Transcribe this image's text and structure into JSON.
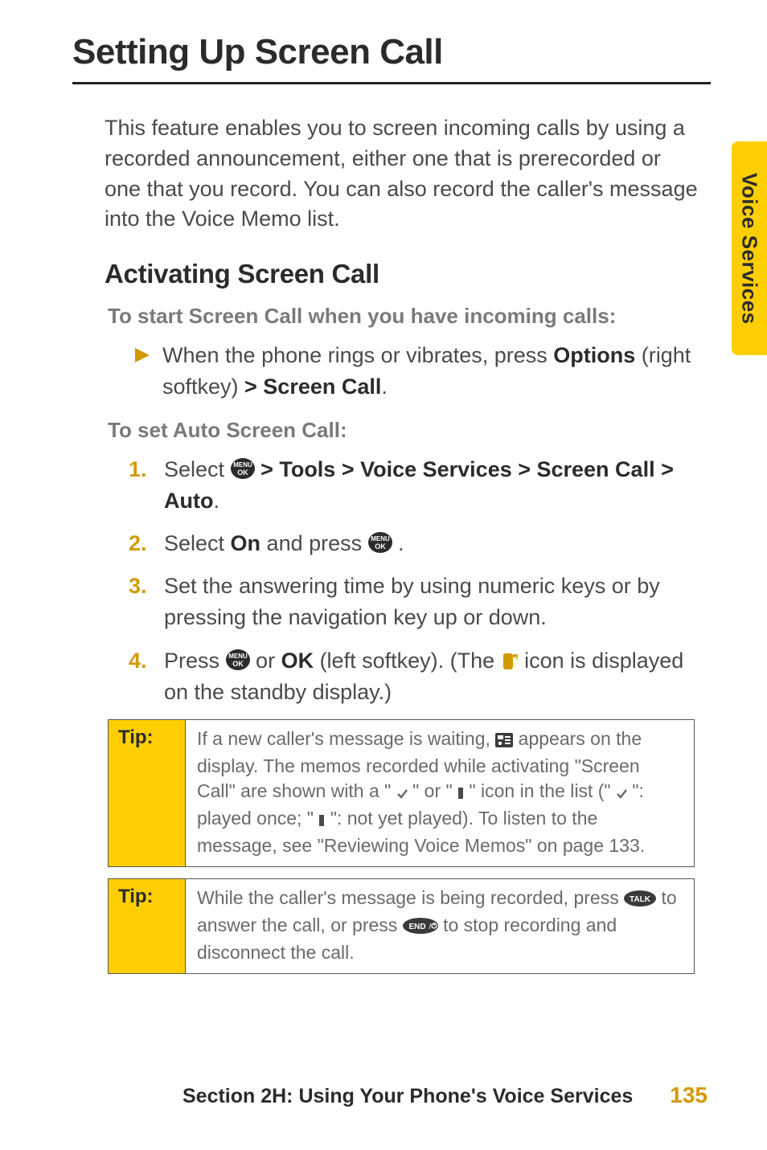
{
  "heading": "Setting Up Screen Call",
  "intro": "This feature enables you to screen incoming calls by using a recorded announcement, either one that is prerecorded or one that you record. You can also record the caller's message into the Voice Memo list.",
  "subheading": "Activating Screen Call",
  "subhead1": "To start Screen Call when you have incoming calls:",
  "bullet": {
    "prefix": "When the phone rings or vibrates, press ",
    "bold1": "Options",
    "mid": " (right softkey) ",
    "bold2": "> Screen Call",
    "suffix": "."
  },
  "subhead2": "To set Auto Screen Call:",
  "steps": {
    "n1": "1.",
    "s1_pre": "Select ",
    "s1_bold": " > Tools > Voice Services > Screen Call > Auto",
    "s1_post": ".",
    "n2": "2.",
    "s2_pre": "Select ",
    "s2_bold": "On",
    "s2_mid": " and press ",
    "s2_post": " .",
    "n3": "3.",
    "s3": "Set the answering time by using numeric keys or by pressing the navigation key up or down.",
    "n4": "4.",
    "s4_pre": "Press ",
    "s4_mid1": " or ",
    "s4_bold": "OK",
    "s4_mid2": " (left softkey). (The ",
    "s4_post": " icon is displayed on the standby display.)"
  },
  "tip1": {
    "label": "Tip:",
    "t_pre": "If a new caller's message is waiting, ",
    "t_mid1": " appears on the display. The memos recorded while activating \"Screen Call\" are shown with a \" ",
    "t_mid2": " \" or \" ",
    "t_mid3": " \" icon in the list (\" ",
    "t_mid4": "\": played once; \" ",
    "t_mid5": "\": not yet played). To listen to the message, see \"Reviewing Voice Memos\" on page 133."
  },
  "tip2": {
    "label": "Tip:",
    "t_pre": "While the caller's message is being recorded, press ",
    "t_mid": " to answer the call, or press ",
    "t_post": " to stop recording and disconnect the call."
  },
  "footer": {
    "section": "Section 2H: Using Your Phone's Voice Services",
    "page": "135"
  },
  "sidetab": "Voice Services",
  "icons": {
    "menu_ok": "menu-ok-icon",
    "screen_call_status": "screen-call-status-icon",
    "msg_waiting": "message-waiting-icon",
    "check": "check-icon",
    "bar": "bar-icon",
    "talk": "talk-key-icon",
    "end": "end-key-icon"
  },
  "chart_data": null
}
